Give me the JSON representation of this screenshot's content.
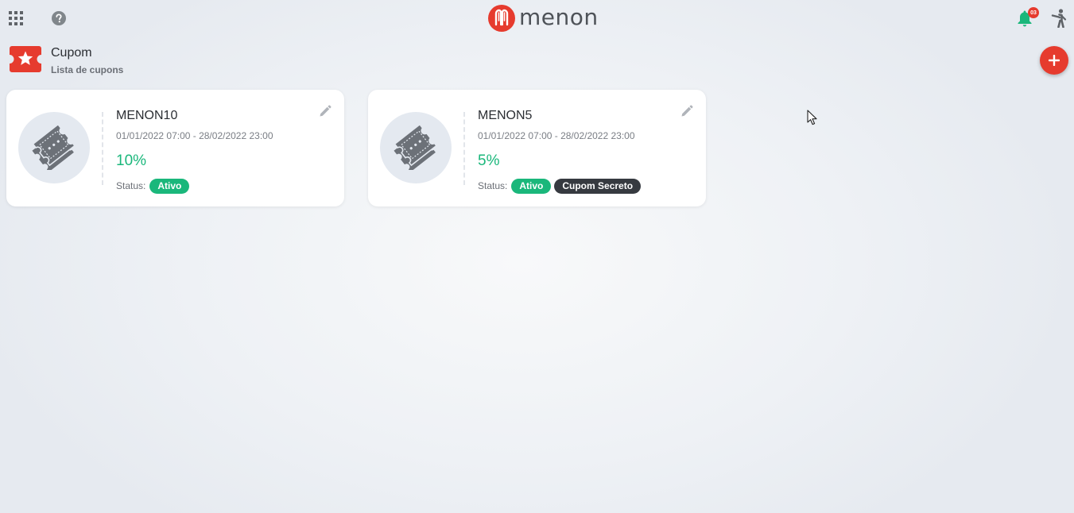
{
  "topbar": {
    "icons": {
      "apps": "apps-grid-icon",
      "help": "help-circle-icon",
      "notifications": "bell-icon",
      "user": "accessibility-person-icon"
    },
    "notification_count": "03",
    "logo_text": "menon"
  },
  "page": {
    "title": "Cupom",
    "subtitle": "Lista de cupons",
    "icon": "ticket-star-icon"
  },
  "add_button": {
    "icon": "plus-icon"
  },
  "coupons": [
    {
      "code": "MENON10",
      "period": "01/01/2022 07:00 - 28/02/2022 23:00",
      "discount": "10%",
      "status_label": "Status:",
      "badges": [
        "Ativo"
      ]
    },
    {
      "code": "MENON5",
      "period": "01/01/2022 07:00 - 28/02/2022 23:00",
      "discount": "5%",
      "status_label": "Status:",
      "badges": [
        "Ativo",
        "Cupom Secreto"
      ]
    }
  ],
  "colors": {
    "brand": "#e63b2e",
    "active_green": "#1ab77b",
    "dark_badge": "#363a40",
    "notification_green": "#1ab77b"
  }
}
